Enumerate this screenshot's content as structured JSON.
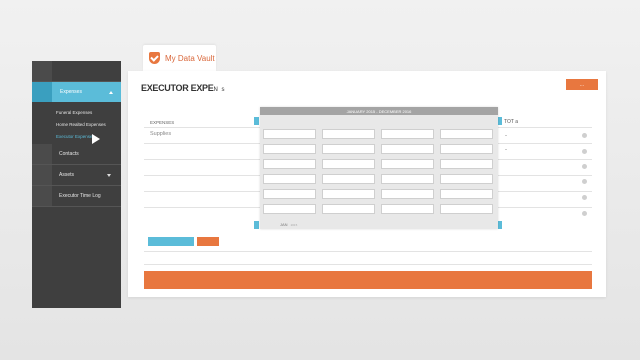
{
  "vault": {
    "title": "My Data Vault"
  },
  "sidebar": {
    "expenses_label": "Expenses",
    "sub_items": [
      {
        "label": "Funeral Expenses"
      },
      {
        "label": "Home Realted Expenses"
      },
      {
        "label": "Executor Expenses"
      }
    ],
    "items": [
      {
        "label": "Contacts"
      },
      {
        "label": "Assets"
      },
      {
        "label": "Executor Time Log"
      }
    ]
  },
  "main": {
    "title": "EXECUTOR EXPE",
    "title_tail": "N s",
    "top_button_label": "...",
    "columns": {
      "expenses": "EXPENSES",
      "total": "TOT a"
    },
    "rows": [
      {
        "label": "Supplies",
        "value": "-"
      },
      {
        "label": "",
        "value": "-"
      },
      {
        "label": "",
        "value": ""
      },
      {
        "label": "",
        "value": ""
      },
      {
        "label": "",
        "value": ""
      },
      {
        "label": "",
        "value": ""
      }
    ]
  },
  "overlay": {
    "header": "JANUARY 2015 - DECEMBER 2016",
    "footer": "JAN",
    "footer_sub": "2015"
  },
  "colors": {
    "accent": "#e8773f",
    "blue": "#5bbcd9",
    "sidebar": "#3f3f3f"
  }
}
